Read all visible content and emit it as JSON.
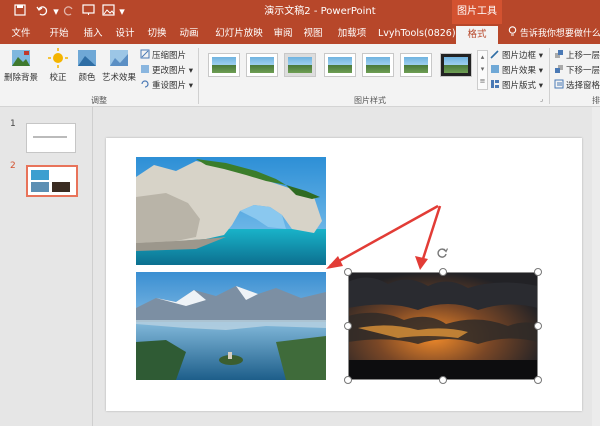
{
  "app": {
    "doc_title": "演示文稿2 - PowerPoint",
    "contextual_tool": "图片工具",
    "accent_color": "#b7472a"
  },
  "quick_access": {
    "save_icon": "save-icon",
    "undo_icon": "undo-icon",
    "redo_icon": "redo-icon"
  },
  "tabs": [
    "文件",
    "开始",
    "插入",
    "设计",
    "切换",
    "动画",
    "幻灯片放映",
    "审阅",
    "视图",
    "加载项",
    "LvyhTools(0826)",
    "格式"
  ],
  "active_tab": "格式",
  "tell_me": "告诉我你想要做什么",
  "ribbon": {
    "adjust": {
      "remove_bg": "删除背景",
      "correct": "校正",
      "color": "颜色",
      "artistic": "艺术效果",
      "compress": "压缩图片",
      "change": "更改图片",
      "reset": "重设图片",
      "group_label": "调整"
    },
    "styles": {
      "group_label": "图片样式",
      "border": "图片边框",
      "effects": "图片效果",
      "layout": "图片版式"
    },
    "arrange": {
      "bring_forward": "上移一层",
      "send_backward": "下移一层",
      "selection_pane": "选择窗格",
      "group_label": "排"
    }
  },
  "slides": [
    {
      "number": "1"
    },
    {
      "number": "2"
    }
  ],
  "canvas": {
    "selected_image": "sunset-clouds-image"
  }
}
